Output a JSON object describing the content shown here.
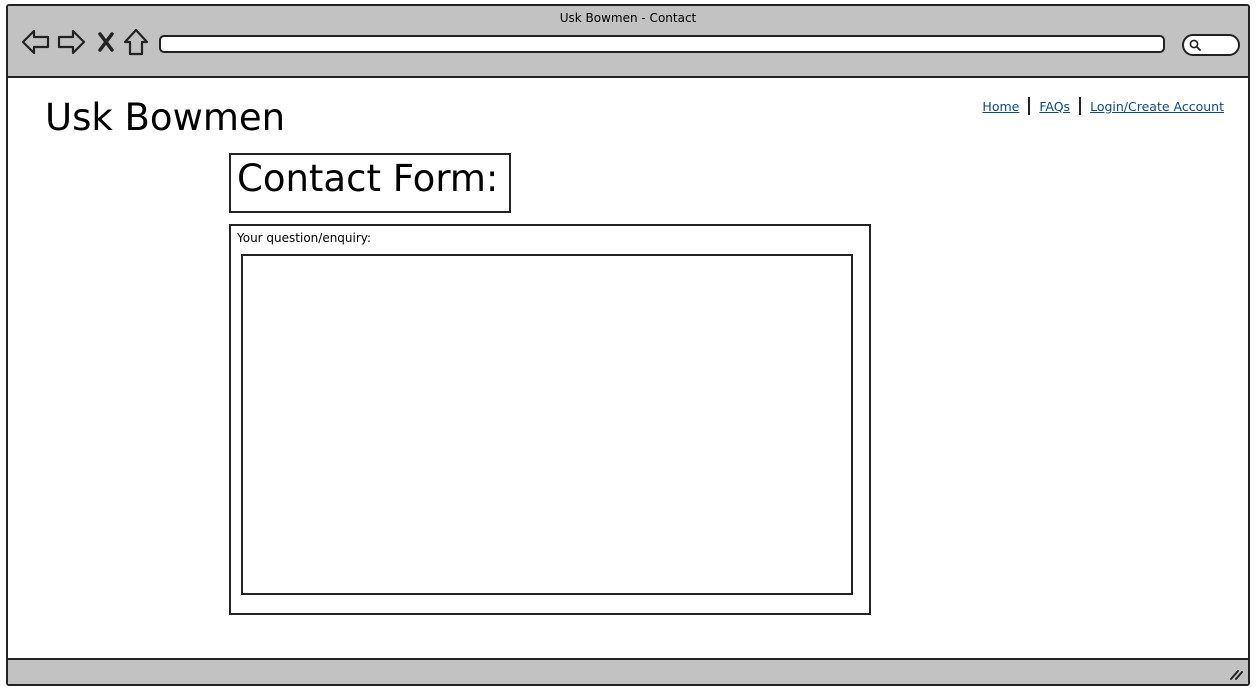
{
  "browser": {
    "window_title": "Usk Bowmen - Contact",
    "address_value": "",
    "icons": [
      "back-arrow-icon",
      "forward-arrow-icon",
      "stop-icon",
      "home-icon",
      "search-icon",
      "resize-grip-icon"
    ]
  },
  "site": {
    "title": "Usk Bowmen"
  },
  "nav": {
    "home": "Home",
    "faqs": "FAQs",
    "login": "Login/Create Account"
  },
  "contact": {
    "heading": "Contact Form:",
    "question_label": "Your question/enquiry:",
    "question_value": ""
  },
  "colors": {
    "chrome": "#c2c2c2",
    "link": "#0b4a86",
    "border": "#222222"
  }
}
